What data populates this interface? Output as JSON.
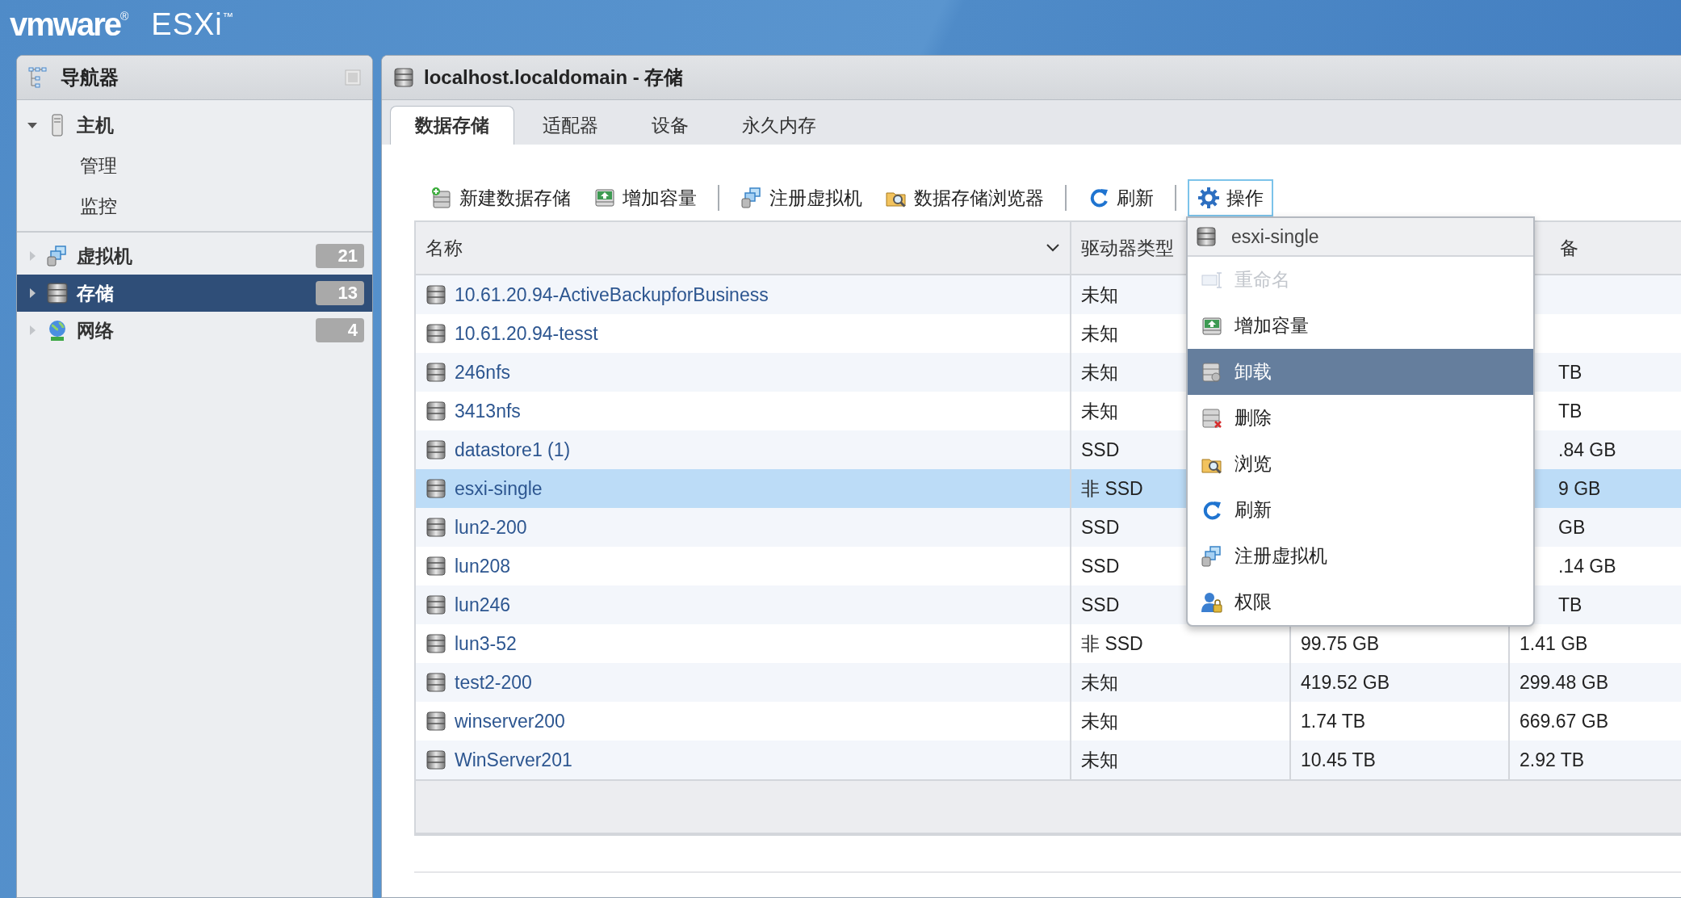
{
  "banner": {
    "brand": "vmware$^{®}$",
    "product": "ESXi$^{™}$"
  },
  "navigator": {
    "title": "导航器",
    "items": [
      {
        "label": "主机",
        "expanded": true,
        "selected": false,
        "children": [
          {
            "label": "管理",
            "selected": false
          },
          {
            "label": "监控",
            "selected": false
          }
        ]
      },
      {
        "label": "虚拟机",
        "expanded": false,
        "selected": false,
        "count": "21"
      },
      {
        "label": "存储",
        "expanded": false,
        "selected": true,
        "count": "13"
      },
      {
        "label": "网络",
        "expanded": false,
        "selected": false,
        "count": "4"
      }
    ]
  },
  "panel": {
    "title": "localhost.localdomain - 存储",
    "tabs": [
      {
        "label": "数据存储",
        "selected": true
      },
      {
        "label": "适配器",
        "selected": false
      },
      {
        "label": "设备",
        "selected": false
      },
      {
        "label": "永久内存",
        "selected": false
      }
    ],
    "toolbar": [
      {
        "label": "新建数据存储",
        "separator_before": false,
        "open": false
      },
      {
        "label": "增加容量",
        "separator_before": false,
        "open": false
      },
      {
        "label": "注册虚拟机",
        "separator_before": true,
        "open": false
      },
      {
        "label": "数据存储浏览器",
        "separator_before": false,
        "open": false
      },
      {
        "label": "刷新",
        "separator_before": true,
        "open": false
      },
      {
        "label": "操作",
        "separator_before": true,
        "open": true
      }
    ],
    "menu": {
      "title": "esxi-single",
      "items": [
        {
          "label": "重命名",
          "disabled": true,
          "selected": false
        },
        {
          "label": "增加容量",
          "disabled": false,
          "selected": false
        },
        {
          "label": "卸载",
          "disabled": false,
          "selected": true
        },
        {
          "label": "删除",
          "disabled": false,
          "selected": false
        },
        {
          "label": "浏览",
          "disabled": false,
          "selected": false
        },
        {
          "label": "刷新",
          "disabled": false,
          "selected": false
        },
        {
          "label": "注册虚拟机",
          "disabled": false,
          "selected": false
        },
        {
          "label": "权限",
          "disabled": false,
          "selected": false
        }
      ]
    },
    "table": {
      "columns": {
        "name": "名称",
        "drive_type": "驱动器类型",
        "column_4": "备"
      },
      "rows": [
        {
          "name": "10.61.20.94-ActiveBackupforBusiness",
          "drive_type": "未知",
          "selected": false
        },
        {
          "name": "10.61.20.94-tesst",
          "drive_type": "未知",
          "selected": false
        },
        {
          "name": "246nfs",
          "drive_type": "未知",
          "column_4": "TB",
          "selected": false
        },
        {
          "name": "3413nfs",
          "drive_type": "未知",
          "column_4": "TB",
          "selected": false
        },
        {
          "name": "datastore1 (1)",
          "drive_type": "SSD",
          "column_4": ".84 GB",
          "selected": false
        },
        {
          "name": "esxi-single",
          "drive_type": "非 SSD",
          "column_4": "9 GB",
          "selected": true
        },
        {
          "name": "lun2-200",
          "drive_type": "SSD",
          "column_4": "GB",
          "selected": false
        },
        {
          "name": "lun208",
          "drive_type": "SSD",
          "column_4": ".14 GB",
          "selected": false
        },
        {
          "name": "lun246",
          "drive_type": "SSD",
          "column_4": "TB",
          "selected": false
        },
        {
          "name": "lun3-52",
          "drive_type": "非 SSD",
          "column_3": "99.75 GB",
          "column_4": "1.41 GB",
          "selected": false
        },
        {
          "name": "test2-200",
          "drive_type": "未知",
          "column_3": "419.52 GB",
          "column_4": "299.48 GB",
          "selected": false
        },
        {
          "name": "winserver200",
          "drive_type": "未知",
          "column_3": "1.74 TB",
          "column_4": "669.67 GB",
          "selected": false
        },
        {
          "name": "WinServer201",
          "drive_type": "未知",
          "column_3": "10.45 TB",
          "column_4": "2.92 TB",
          "selected": false
        }
      ]
    }
  }
}
